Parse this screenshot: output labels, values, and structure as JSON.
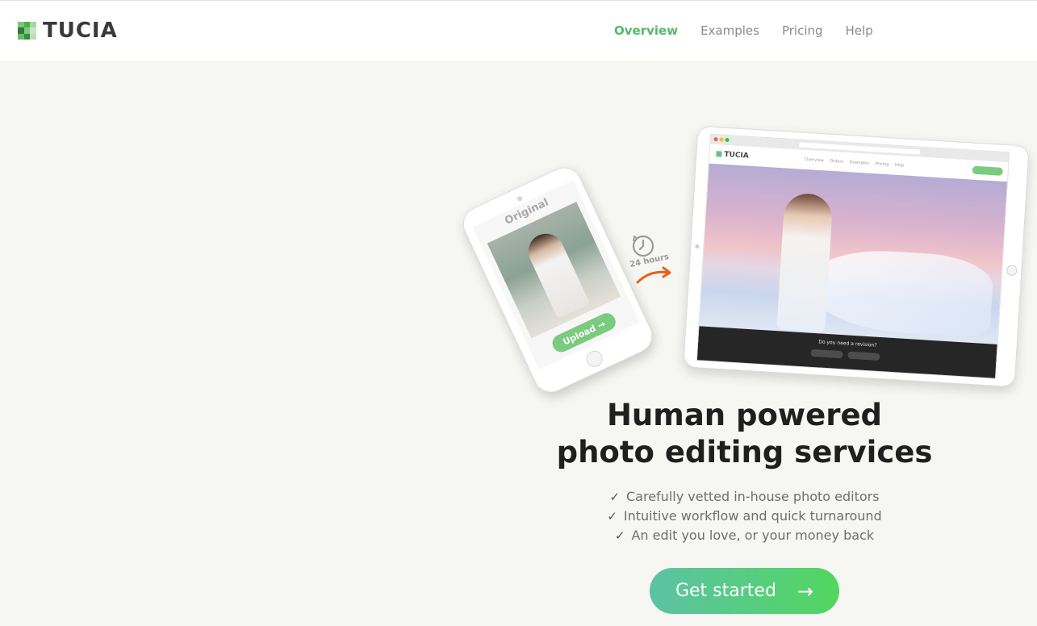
{
  "brand": {
    "name": "TUCIA",
    "logo_colors": [
      "#7bc67e",
      "#4caf50",
      "#a5d6a7",
      "#2e7d32",
      "#81c784",
      "#c8e6c9",
      "#66bb6a",
      "#388e3c",
      "#b9dfb9"
    ]
  },
  "nav": {
    "items": [
      {
        "label": "Overview",
        "active": true
      },
      {
        "label": "Examples",
        "active": false
      },
      {
        "label": "Pricing",
        "active": false
      },
      {
        "label": "Help",
        "active": false
      }
    ],
    "active_color": "#55b96d"
  },
  "illustration": {
    "phone_label": "Original",
    "phone_upload_label": "Upload →",
    "turnaround_label": "24 hours",
    "tablet_logo": "TUCIA",
    "tablet_nav": "Overview Orders Examples Pricing Help",
    "tablet_revision_prompt": "Do you need a revision?"
  },
  "hero": {
    "title_line1": "Human powered",
    "title_line2": "photo editing services",
    "features": [
      "Carefully vetted in-house photo editors",
      "Intuitive workflow and quick turnaround",
      "An edit you love, or your money back"
    ],
    "cta_label": "Get started",
    "cta_arrow": "→"
  }
}
